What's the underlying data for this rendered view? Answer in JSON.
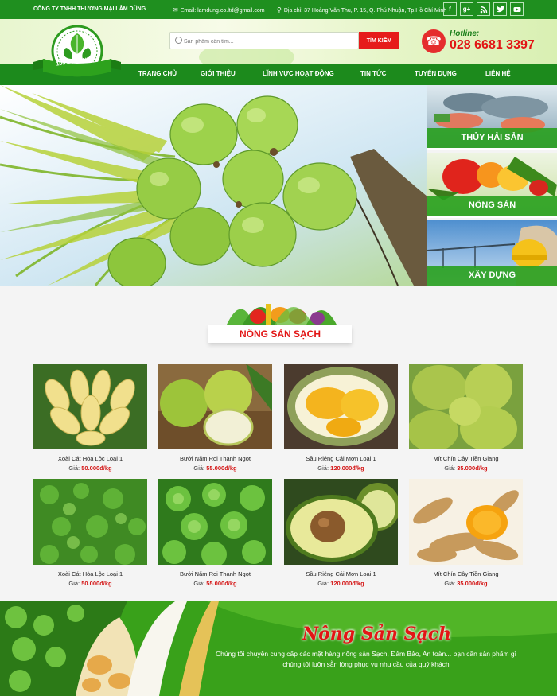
{
  "topbar": {
    "company": "CÔNG TY TNHH THƯƠNG MẠI LÂM DŨNG",
    "email": "Email: lamdung.co.ltd@gmail.com",
    "address": "Địa chỉ: 37 Hoàng Văn Thụ, P. 15, Q. Phú Nhuận, Tp.Hồ Chí Minh",
    "socials": [
      "f",
      "g+",
      "rss",
      "t",
      "yt"
    ]
  },
  "header": {
    "logo_text": "100% NATURAL",
    "search_placeholder": "Sản phẩm cần tìm...",
    "search_button": "TÌM KIẾM",
    "hotline_label": "Hotline:",
    "hotline_number": "028 6681 3397"
  },
  "nav": [
    "TRANG CHỦ",
    "GIỚI THIỆU",
    "LĨNH VỰC HOẠT ĐỘNG",
    "TIN TỨC",
    "TUYỂN DỤNG",
    "LIÊN HỆ"
  ],
  "side_categories": [
    "THỦY HẢI SẢN",
    "NÔNG SẢN",
    "XÂY DỰNG"
  ],
  "section_title": "NÔNG SẢN SẠCH",
  "price_label": "Giá:",
  "products": [
    {
      "name": "Xoài Cát Hòa Lộc Loại 1",
      "price": "50.000đ/kg"
    },
    {
      "name": "Bưởi Năm Roi Thanh Ngọt",
      "price": "55.000đ/kg"
    },
    {
      "name": "Sầu Riêng Cái Mơn Loại 1",
      "price": "120.000đ/kg"
    },
    {
      "name": "Mít Chín Cây Tiền Giang",
      "price": "35.000đ/kg"
    },
    {
      "name": "Xoài Cát Hòa Lộc Loại 1",
      "price": "50.000đ/kg"
    },
    {
      "name": "Bưởi Năm Roi Thanh Ngọt",
      "price": "55.000đ/kg"
    },
    {
      "name": "Sầu Riêng Cái Mơn Loại 1",
      "price": "120.000đ/kg"
    },
    {
      "name": "Mít Chín Cây Tiền Giang",
      "price": "35.000đ/kg"
    }
  ],
  "footer": {
    "title": "Nông Sản Sạch",
    "description": "Chúng tôi chuyên cung cấp các mặt hàng nông sản Sạch, Đảm Bảo, An toàn... bạn cần sản phẩm gì chúng tôi luôn sẵn lòng phục vụ nhu cầu của quý khách"
  }
}
